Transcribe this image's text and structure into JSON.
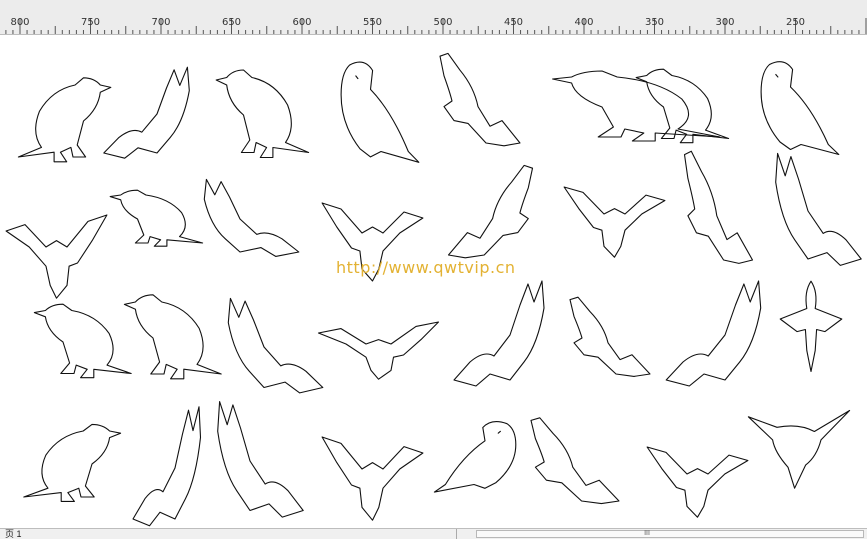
{
  "ruler": {
    "labels": [
      "800",
      "750",
      "700",
      "650",
      "600",
      "550",
      "500",
      "450",
      "400",
      "350",
      "300",
      "250"
    ]
  },
  "canvas": {
    "watermark": "http://www.qwtvip.cn",
    "birds": [
      "crow-standing-icon",
      "bird-wings-raised-icon",
      "finch-perched-icon",
      "parrot-perched-icon",
      "eagle-flying-icon",
      "parrot-longtail-icon",
      "crow-walking-icon",
      "macaw-perched-icon",
      "hawk-swooping-icon",
      "parakeet-perched-icon",
      "gull-flying-icon",
      "hawk-soaring-icon",
      "parrot-flying-icon",
      "falcon-diving-icon",
      "eagle-landing-icon",
      "dove-flying-icon",
      "sparrow-standing-icon",
      "finch-standing-icon",
      "pigeon-flying-icon",
      "heron-flying-icon",
      "parrot-flapping-icon",
      "kite-gliding-icon",
      "parrot-soaring-icon",
      "swallow-topdown-icon",
      "sparrow-sitting-icon",
      "bird-landing-icon",
      "seagull-gliding-icon",
      "eagle-wings-up-icon",
      "lovebird-perched-icon",
      "hawk-landing-icon",
      "owl-flying-icon",
      "hummingbird-hovering-icon"
    ]
  },
  "statusbar": {
    "page_label": "页 1",
    "scroll_thumb_label": "III"
  },
  "colors": {
    "watermark": "#e3b233",
    "ruler_bg": "#ececec",
    "line": "#111111"
  }
}
